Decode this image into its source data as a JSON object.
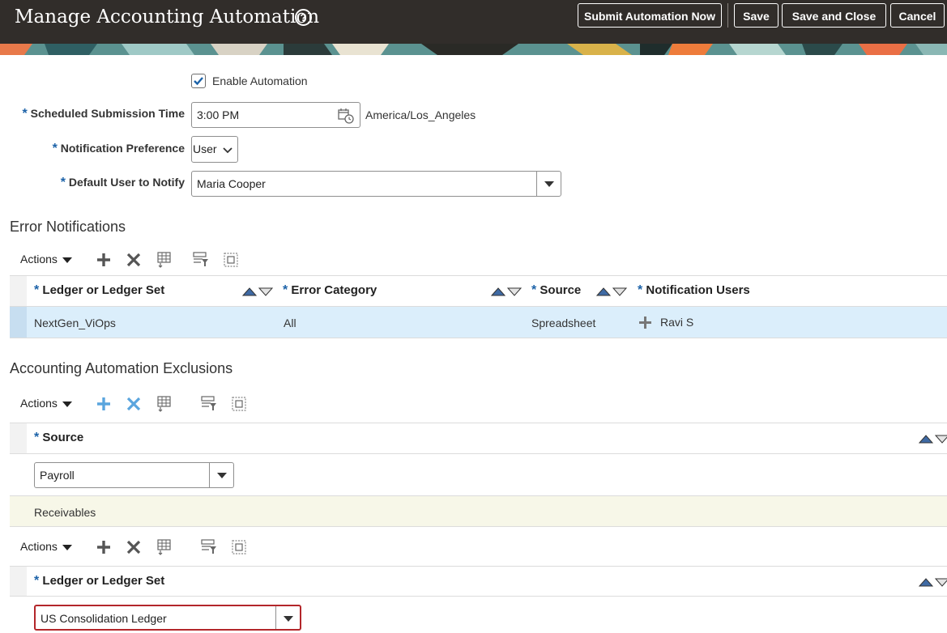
{
  "header": {
    "title": "Manage Accounting Automation",
    "buttons": {
      "submit_now": "Submit Automation Now",
      "save": "Save",
      "save_close": "Save and Close",
      "cancel": "Cancel"
    }
  },
  "form": {
    "enable_automation": {
      "label": "Enable Automation",
      "checked": true
    },
    "scheduled_time": {
      "label": "Scheduled Submission Time",
      "value": "3:00 PM",
      "timezone": "America/Los_Angeles"
    },
    "notification_preference": {
      "label": "Notification Preference",
      "value": "User"
    },
    "default_user": {
      "label": "Default User to Notify",
      "value": "Maria Cooper"
    },
    "required_marker": "*"
  },
  "error_notifications": {
    "title": "Error Notifications",
    "actions_label": "Actions",
    "columns": [
      "Ledger or Ledger Set",
      "Error Category",
      "Source",
      "Notification Users"
    ],
    "rows": [
      {
        "ledger": "NextGen_ViOps",
        "category": "All",
        "source": "Spreadsheet",
        "users": "Ravi S"
      }
    ]
  },
  "exclusions": {
    "title": "Accounting Automation Exclusions",
    "actions_label": "Actions",
    "source_column": "Source",
    "source_rows": [
      "Payroll",
      "Receivables"
    ],
    "ledger_actions_label": "Actions",
    "ledger_column": "Ledger or Ledger Set",
    "ledger_rows": [
      "US Consolidation Ledger"
    ]
  },
  "colors": {
    "header_bg": "#312d2a",
    "accent_blue": "#1c62a8",
    "selected_row": "#dbeefb",
    "highlight_row": "#f7f7e8",
    "error_border": "#b3262a"
  }
}
